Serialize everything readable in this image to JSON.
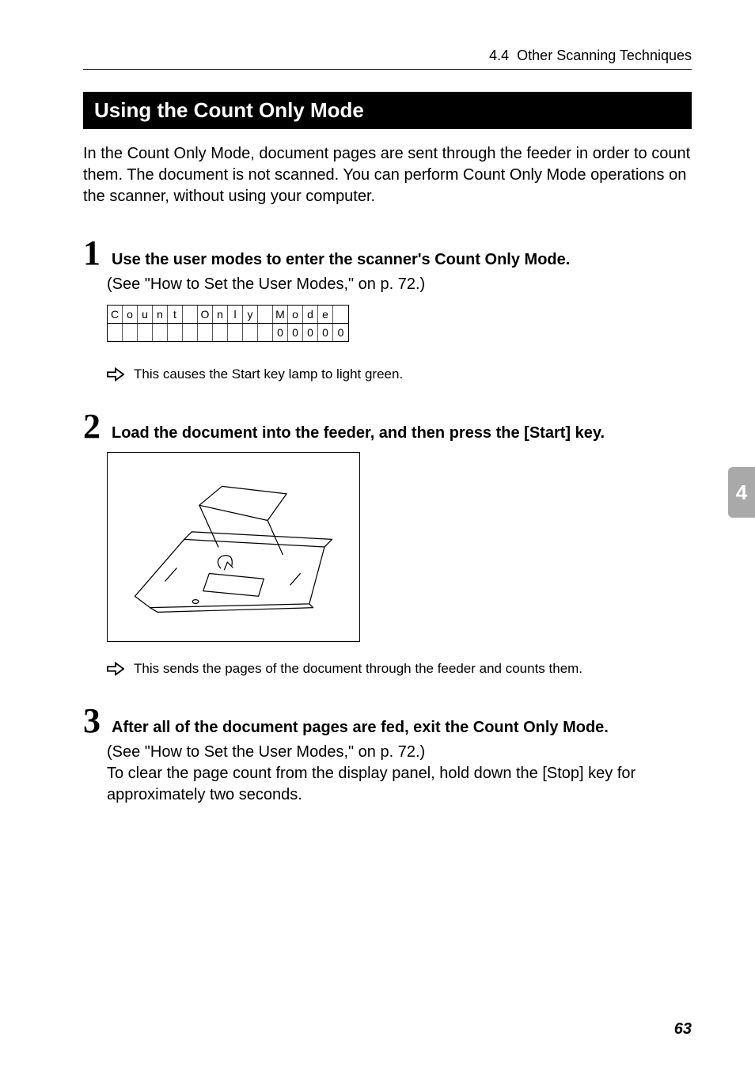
{
  "header": {
    "section_ref": "4.4",
    "section_name": "Other Scanning Techniques"
  },
  "title": "Using the Count Only Mode",
  "intro": "In the Count Only Mode, document pages are sent through the feeder in order to count them. The document is not scanned. You can perform Count Only Mode operations on the scanner, without using your computer.",
  "steps": [
    {
      "num": "1",
      "title": "Use the user modes to enter the scanner's Count Only Mode.",
      "body": "(See \"How to Set the User Modes,\" on p. 72.)",
      "lcd": {
        "row1": [
          "C",
          "o",
          "u",
          "n",
          "t",
          "",
          "O",
          "n",
          "l",
          "y",
          "",
          "M",
          "o",
          "d",
          "e",
          ""
        ],
        "row2": [
          "",
          "",
          "",
          "",
          "",
          "",
          "",
          "",
          "",
          "",
          "",
          "0",
          "0",
          "0",
          "0",
          "0"
        ]
      },
      "result": "This causes the Start key lamp to light green."
    },
    {
      "num": "2",
      "title": "Load the document into the feeder, and then press the [Start] key.",
      "result": "This sends the pages of the document through the feeder and counts them."
    },
    {
      "num": "3",
      "title": "After all of the document pages are fed, exit the Count Only Mode.",
      "body": "(See \"How to Set the User Modes,\" on p. 72.)\nTo clear the page count from the display panel, hold down the [Stop] key for approximately two seconds."
    }
  ],
  "side_tab": "4",
  "page_number": "63"
}
